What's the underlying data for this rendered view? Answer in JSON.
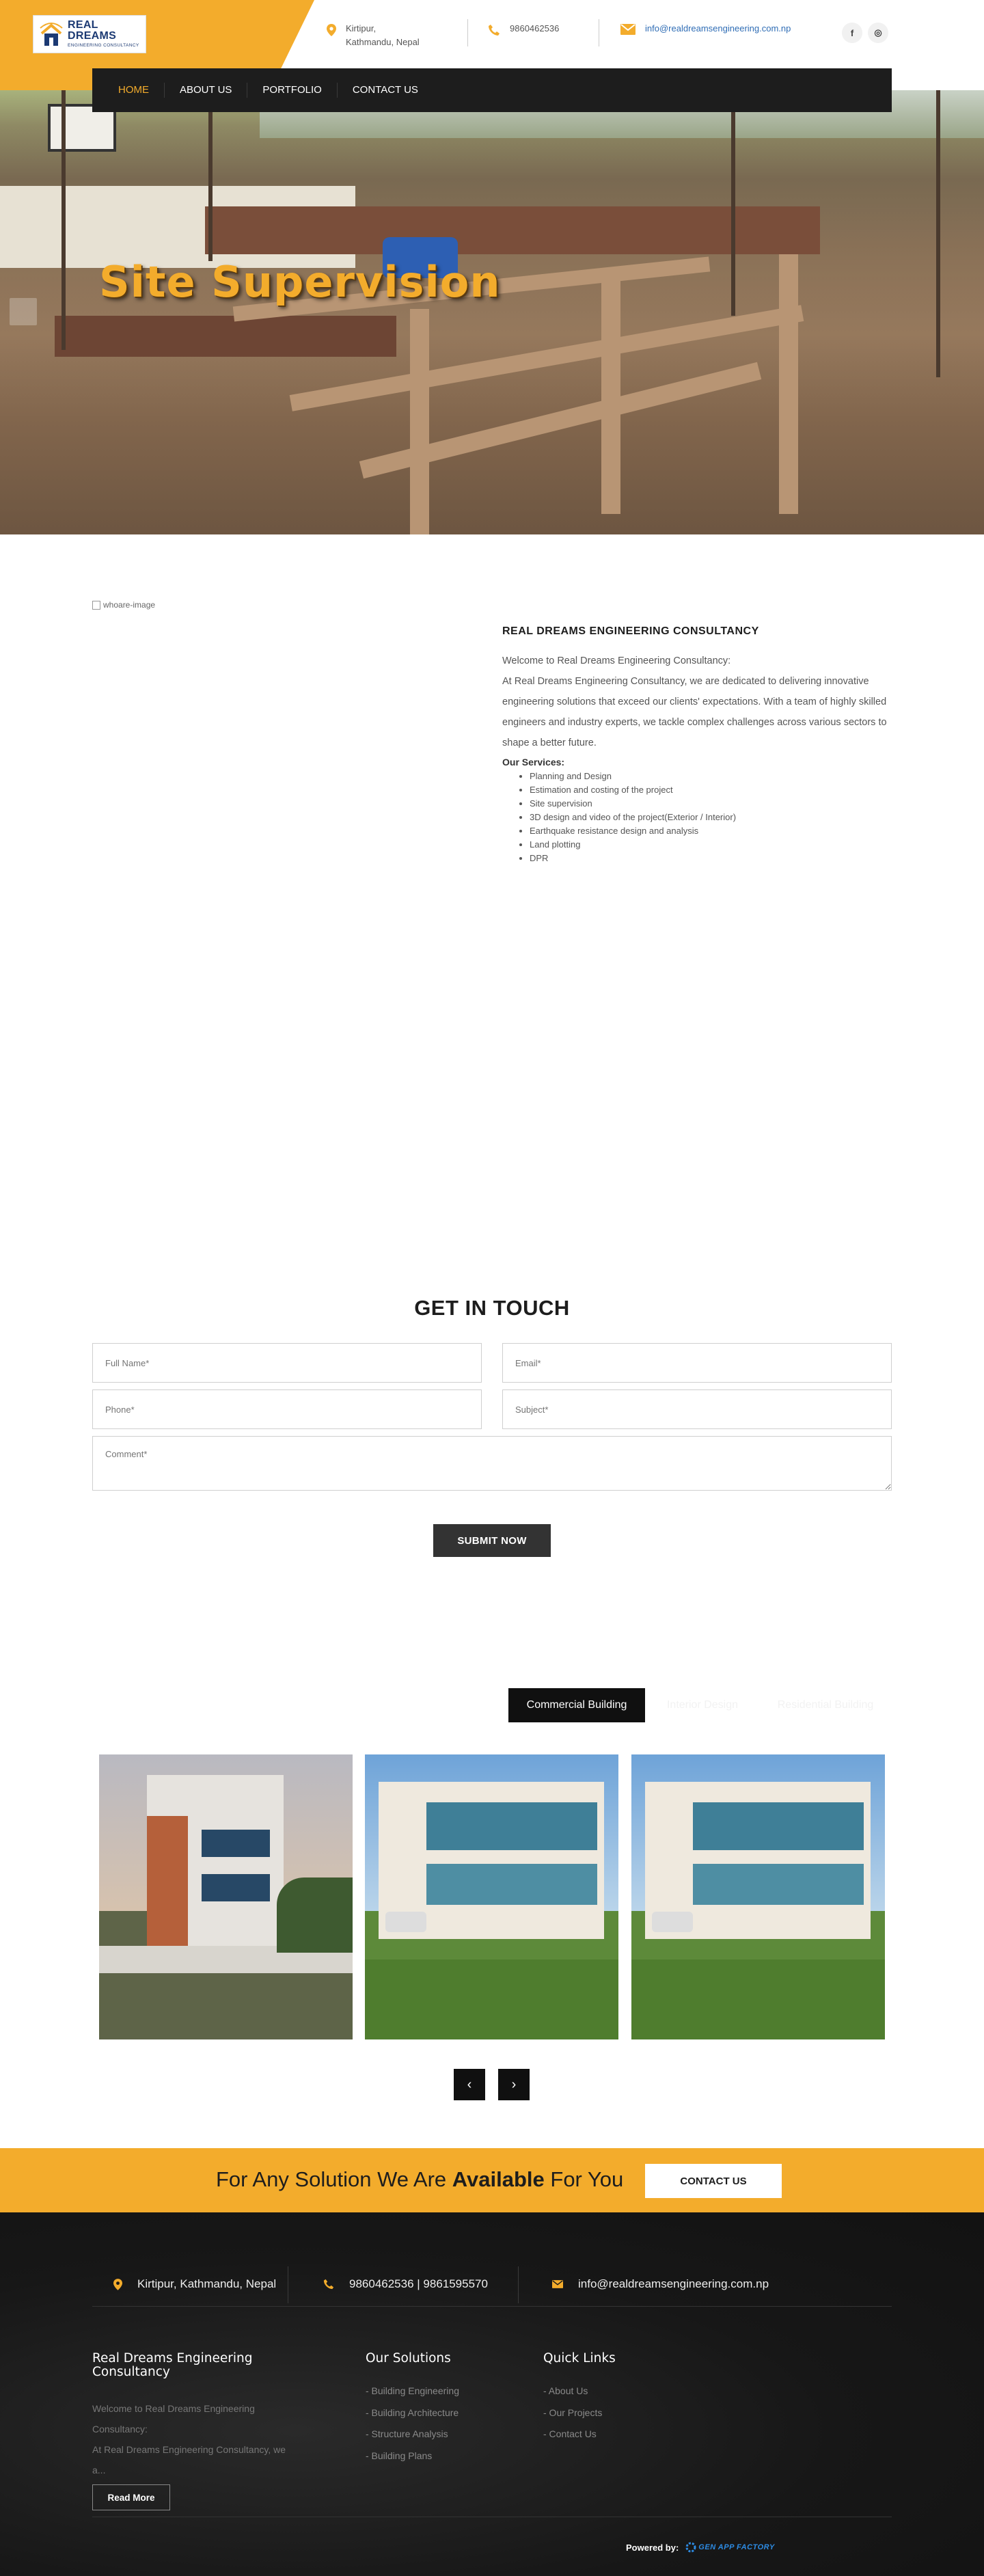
{
  "brand": {
    "name": "REAL DREAMS",
    "tagline": "ENGINEERING CONSULTANCY"
  },
  "header": {
    "address_line1": "Kirtipur,",
    "address_line2": "Kathmandu, Nepal",
    "phone": "9860462536",
    "email": "info@realdreamsengineering.com.np"
  },
  "social": [
    {
      "icon": "facebook-icon",
      "glyph": "f"
    },
    {
      "icon": "instagram-icon",
      "glyph": "◎"
    }
  ],
  "nav": [
    {
      "label": "HOME",
      "active": true
    },
    {
      "label": "ABOUT US",
      "active": false
    },
    {
      "label": "PORTFOLIO",
      "active": false
    },
    {
      "label": "CONTACT US",
      "active": false
    }
  ],
  "hero": {
    "title": "Site Supervision"
  },
  "about": {
    "image_alt": "whoare-image",
    "heading": "REAL DREAMS ENGINEERING CONSULTANCY",
    "welcome": "Welcome to Real Dreams Engineering Consultancy:",
    "intro": "At Real Dreams Engineering Consultancy, we are dedicated to delivering innovative engineering solutions that exceed our clients' expectations. With a team of highly skilled engineers and industry experts, we tackle complex challenges across various sectors to shape a better future.",
    "services_title": "Our Services:",
    "services": [
      "Planning and Design",
      "Estimation and costing of the project",
      "Site supervision",
      "3D design and video of the project(Exterior / Interior)",
      "Earthquake resistance design and analysis",
      "Land plotting",
      "DPR"
    ]
  },
  "contact_form": {
    "title": "GET IN TOUCH",
    "full_name_placeholder": "Full Name*",
    "email_placeholder": "Email*",
    "phone_placeholder": "Phone*",
    "subject_placeholder": "Subject*",
    "comment_placeholder": "Comment*",
    "submit_label": "SUBMIT NOW"
  },
  "portfolio": {
    "tabs": [
      {
        "label": "Commercial Building",
        "active": true
      },
      {
        "label": "Interior Design",
        "active": false
      },
      {
        "label": "Residential Building",
        "active": false
      }
    ],
    "prev_glyph": "‹",
    "next_glyph": "›"
  },
  "cta": {
    "text_before": "For Any Solution We Are ",
    "text_bold": "Available",
    "text_after": " For You",
    "button_label": "CONTACT US"
  },
  "footer": {
    "address": "Kirtipur, Kathmandu, Nepal",
    "phones": "9860462536 | 9861595570",
    "email": "info@realdreamsengineering.com.np",
    "about_heading_1": "Real Dreams Engineering",
    "about_heading_2": "Consultancy",
    "about_line1": "Welcome to Real Dreams Engineering",
    "about_line2": "Consultancy:",
    "about_line3": "At Real Dreams Engineering Consultancy, we",
    "about_line4": "a...",
    "read_more": "Read More",
    "solutions_heading": "Our Solutions",
    "solutions": [
      "- Building Engineering",
      "- Building Architecture",
      "- Structure Analysis",
      "- Building Plans"
    ],
    "quick_heading": "Quick Links",
    "quick_links": [
      "- About Us",
      "- Our Projects",
      "- Contact Us"
    ],
    "powered_by": "Powered by:",
    "powered_logo": "GEN APP FACTORY"
  },
  "colors": {
    "accent": "#f3ac2c",
    "dark": "#1d1d1d",
    "link": "#2f6db5"
  }
}
